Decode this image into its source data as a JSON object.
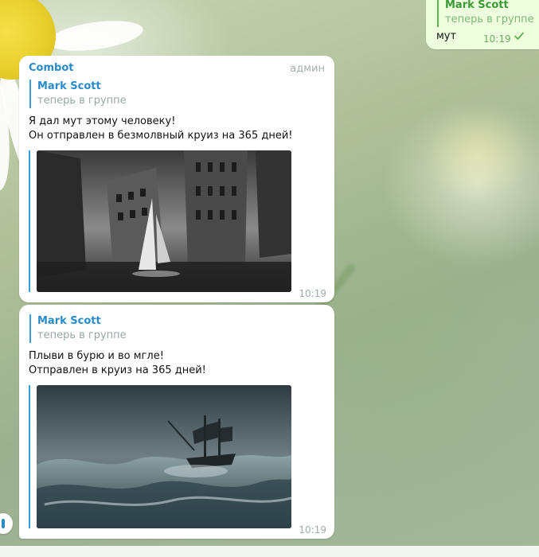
{
  "outgoing": {
    "reply_name": "Mark Scott",
    "reply_sub": "теперь в группе",
    "text": "мут",
    "time": "10:19"
  },
  "messages": [
    {
      "sender": "Combot",
      "role": "админ",
      "reply_name": "Mark Scott",
      "reply_sub": "теперь в группе",
      "lines": [
        "Я дал мут этому человеку!",
        "Он отправлен в безмолвный круиз на 365 дней!"
      ],
      "time": "10:19"
    },
    {
      "reply_name": "Mark Scott",
      "reply_sub": "теперь в группе",
      "lines": [
        "Плыви в бурю и во мгле!",
        "Отправлен в круиз на 365 дней!"
      ],
      "time": "10:19"
    }
  ],
  "colors": {
    "accent": "#2a8bc9",
    "outgoing_bubble": "#eeffde",
    "incoming_bubble": "#ffffff"
  },
  "icons": {
    "read_status": "check-icon"
  }
}
